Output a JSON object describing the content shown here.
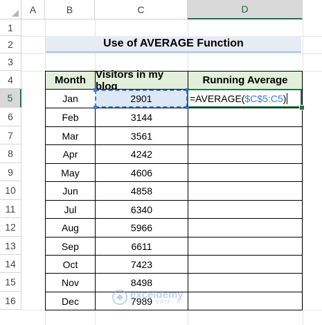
{
  "columns": [
    "A",
    "B",
    "C",
    "D"
  ],
  "rows": [
    "1",
    "2",
    "3",
    "4",
    "5",
    "6",
    "7",
    "8",
    "9",
    "10",
    "11",
    "12",
    "13",
    "14",
    "15",
    "16"
  ],
  "title": "Use of AVERAGE Function",
  "headers": {
    "month": "Month",
    "visitors": "Visitors in my blog",
    "running": "Running Average"
  },
  "table": [
    {
      "month": "Jan",
      "visitors": "2901"
    },
    {
      "month": "Feb",
      "visitors": "3144"
    },
    {
      "month": "Mar",
      "visitors": "3561"
    },
    {
      "month": "Apr",
      "visitors": "4242"
    },
    {
      "month": "May",
      "visitors": "4606"
    },
    {
      "month": "Jun",
      "visitors": "4858"
    },
    {
      "month": "Jul",
      "visitors": "6340"
    },
    {
      "month": "Aug",
      "visitors": "5966"
    },
    {
      "month": "Sep",
      "visitors": "6611"
    },
    {
      "month": "Oct",
      "visitors": "7423"
    },
    {
      "month": "Nov",
      "visitors": "8498"
    },
    {
      "month": "Dec",
      "visitors": "7989"
    }
  ],
  "formula": {
    "prefix": "=AVERAGE(",
    "ref": "$C$5:C5",
    "suffix": ")"
  },
  "watermark": {
    "name": "exceldemy",
    "sub": "EXCEL · DATA · BI"
  },
  "colors": {
    "header_fill": "#e2efda",
    "title_fill": "#e7ebf3",
    "selection": "#217346",
    "reference": "#3d7bd6"
  }
}
